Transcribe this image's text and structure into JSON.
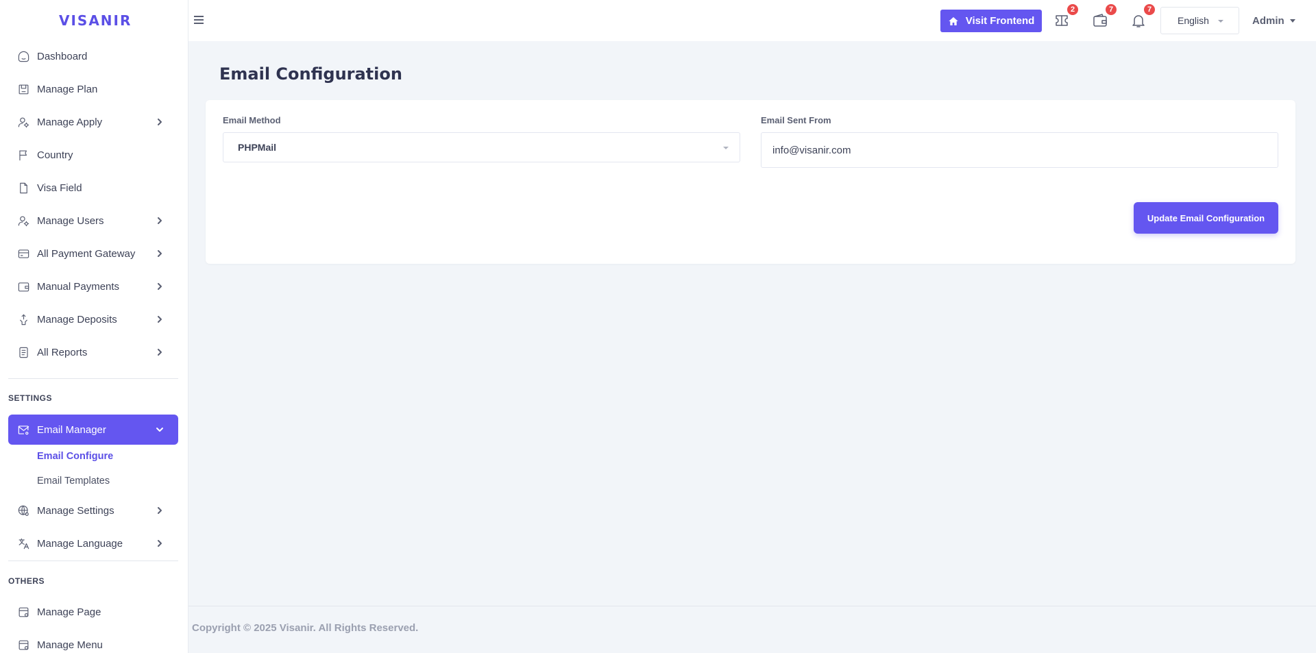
{
  "brand": "VISANIR",
  "sidebar": {
    "items": [
      {
        "label": "Dashboard"
      },
      {
        "label": "Manage Plan"
      },
      {
        "label": "Manage Apply"
      },
      {
        "label": "Country"
      },
      {
        "label": "Visa Field"
      },
      {
        "label": "Manage Users"
      },
      {
        "label": "All Payment Gateway"
      },
      {
        "label": "Manual Payments"
      },
      {
        "label": "Manage Deposits"
      },
      {
        "label": "All Reports"
      }
    ],
    "settings_label": "SETTINGS",
    "email_manager": {
      "label": "Email Manager",
      "sub": [
        {
          "label": "Email Configure"
        },
        {
          "label": "Email Templates"
        }
      ]
    },
    "settings_items": [
      {
        "label": "Manage Settings"
      },
      {
        "label": "Manage Language"
      }
    ],
    "others_label": "OTHERS",
    "others_items": [
      {
        "label": "Manage Page"
      },
      {
        "label": "Manage Menu"
      }
    ]
  },
  "header": {
    "visit_frontend": "Visit Frontend",
    "badges": {
      "tickets": "2",
      "wallet": "7",
      "notifications": "7"
    },
    "language": "English",
    "admin": "Admin"
  },
  "main": {
    "title": "Email Configuration",
    "email_method_label": "Email Method",
    "email_method_value": "PHPMail",
    "email_from_label": "Email Sent From",
    "email_from_value": "info@visanir.com",
    "update_button": "Update Email Configuration"
  },
  "footer": {
    "copyright": "Copyright © 2025 Visanir. All Rights Reserved."
  },
  "colors": {
    "accent": "#6456f0",
    "badge": "#ea4a4a",
    "background": "#f2f5f9"
  }
}
